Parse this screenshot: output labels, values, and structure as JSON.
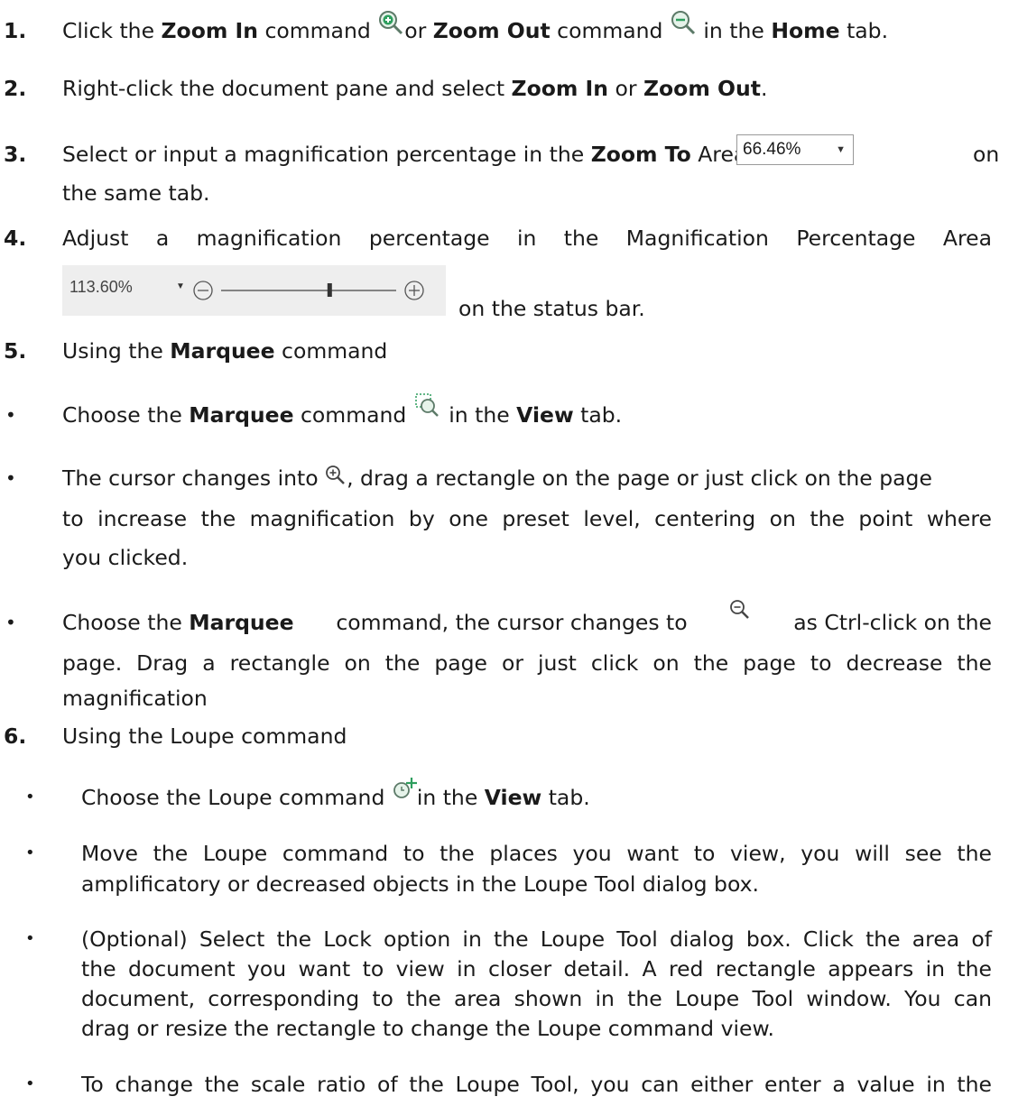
{
  "items": {
    "s1": {
      "num": "1.",
      "t1": "Click the ",
      "b1": "Zoom In",
      "t2": " command ",
      "t3": "or ",
      "b2": "Zoom Out",
      "t4": " command ",
      "t5": " in the ",
      "b3": "Home",
      "t6": " tab."
    },
    "s2": {
      "num": "2.",
      "t1": "Right-click the document pane and select ",
      "b1": "Zoom In",
      "t2": " or ",
      "b2": "Zoom Out",
      "t3": "."
    },
    "s3": {
      "num": "3.",
      "t1": "Select or input a magnification percentage in the ",
      "b1": "Zoom To",
      "t2": " Area",
      "after": "on",
      "line2": "the same tab.",
      "zoom_value": "66.46%"
    },
    "s4": {
      "num": "4.",
      "line1": "Adjust a magnification percentage in the Magnification Percentage Area",
      "after": "on the status bar.",
      "status_value": "113.60%",
      "slider_level": 0.62
    },
    "s5": {
      "num": "5.",
      "t1": "Using the ",
      "b1": "Marquee",
      "t2": " command"
    },
    "b5a": {
      "t1": "Choose the ",
      "b1": "Marquee",
      "t2": " command ",
      "t3": " in the ",
      "b2": "View",
      "t4": " tab."
    },
    "b5b": {
      "l1a": "The cursor changes into ",
      "l1b": ", drag a rectangle on the page or just click on the page",
      "l2": "to increase the magnification by one preset level, centering on the point where",
      "l3": "you clicked."
    },
    "b5c": {
      "t1": "Choose the ",
      "b1": "Marquee",
      "t2": " command, the cursor changes to ",
      "t3": " as Ctrl-click on the",
      "l2": "page. Drag a rectangle on the page or just click on the page to decrease the",
      "l3": "magnification"
    },
    "s6": {
      "num": "6.",
      "t1": "Using the Loupe command"
    },
    "b6a": {
      "t1": "Choose the Loupe command ",
      "t2": "in the ",
      "b1": "View",
      "t3": " tab."
    },
    "b6b": {
      "l1": "Move the Loupe command to the places you want to view, you will see the",
      "l2": "amplificatory or decreased objects in the Loupe Tool dialog box."
    },
    "b6c": {
      "l1": "(Optional) Select the Lock option in the Loupe Tool dialog box. Click the area of",
      "l2": "the document you want to view in closer detail. A red rectangle appears in the",
      "l3": "document, corresponding to the area shown in the Loupe Tool window. You can",
      "l4": "drag or resize the rectangle to change the Loupe command view."
    },
    "b6d": {
      "l1": "To change the scale ratio of the Loupe Tool, you can either enter a value in the"
    }
  },
  "bullet_char": "•",
  "icons": {
    "zoom_in": "zoom-in-icon",
    "zoom_out": "zoom-out-icon",
    "marquee": "marquee-icon",
    "cursor_in": "cursor-zoom-in-icon",
    "cursor_out": "cursor-zoom-out-icon",
    "loupe": "loupe-icon"
  },
  "colors": {
    "icon_green": "#2e9e5e",
    "icon_gray": "#555555",
    "text": "#1a1a1a"
  }
}
